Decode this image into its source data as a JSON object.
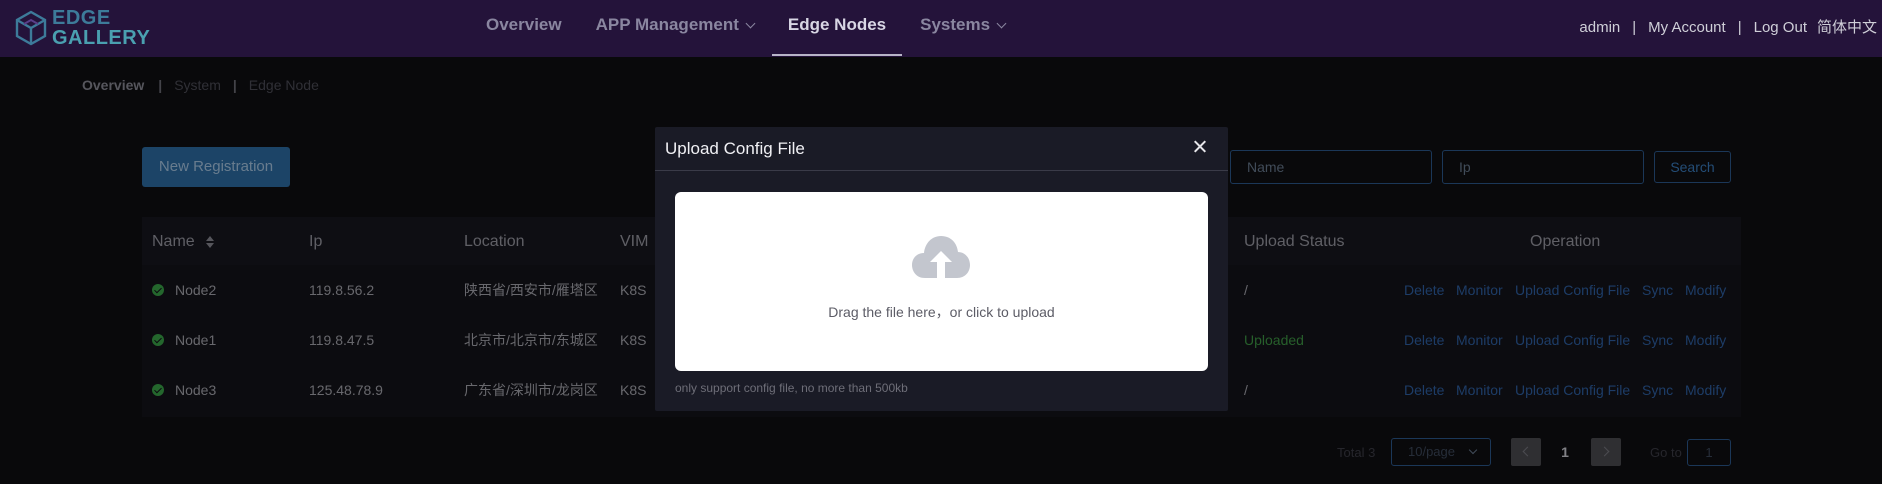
{
  "header": {
    "logo_line1": "EDGE",
    "logo_line2": "GALLERY",
    "nav": [
      {
        "label": "Overview",
        "active": false,
        "dropdown": false
      },
      {
        "label": "APP Management",
        "active": false,
        "dropdown": true
      },
      {
        "label": "Edge Nodes",
        "active": true,
        "dropdown": false
      },
      {
        "label": "Systems",
        "active": false,
        "dropdown": true
      }
    ],
    "user": {
      "name": "admin",
      "account": "My Account",
      "logout": "Log Out",
      "language": "简体中文",
      "separator": "|"
    }
  },
  "breadcrumb": {
    "items": [
      "Overview",
      "System",
      "Edge Node"
    ],
    "separator": "|"
  },
  "toolbar": {
    "new_button": "New Registration",
    "name_placeholder": "Name",
    "ip_placeholder": "Ip",
    "search_button": "Search"
  },
  "table": {
    "columns": [
      "Name",
      "Ip",
      "Location",
      "VIM",
      "Upload Status",
      "Operation"
    ],
    "rows": [
      {
        "name": "Node2",
        "ip": "119.8.56.2",
        "location": "陕西省/西安市/雁塔区",
        "vim": "K8S",
        "upload_status": "/",
        "status": "online"
      },
      {
        "name": "Node1",
        "ip": "119.8.47.5",
        "location": "北京市/北京市/东城区",
        "vim": "K8S",
        "upload_status": "Uploaded",
        "status": "online"
      },
      {
        "name": "Node3",
        "ip": "125.48.78.9",
        "location": "广东省/深圳市/龙岗区",
        "vim": "K8S",
        "upload_status": "/",
        "status": "online"
      }
    ],
    "operations": [
      "Delete",
      "Monitor",
      "Upload Config File",
      "Sync",
      "Modify"
    ]
  },
  "pagination": {
    "total_text": "Total 3",
    "page_size": "10/page",
    "current_page": "1",
    "goto_label": "Go to",
    "goto_value": "1"
  },
  "dialog": {
    "title": "Upload Config File",
    "drop_text": "Drag the file here，or click to upload",
    "tip": "only support config file, no more than 500kb",
    "icons": {
      "close": "close-icon",
      "upload": "cloud-upload-icon"
    }
  },
  "colors": {
    "header_bg": "#24133a",
    "accent": "#2e6ea6",
    "success": "#3aa64a",
    "dialog_bg": "#1a1b26"
  }
}
